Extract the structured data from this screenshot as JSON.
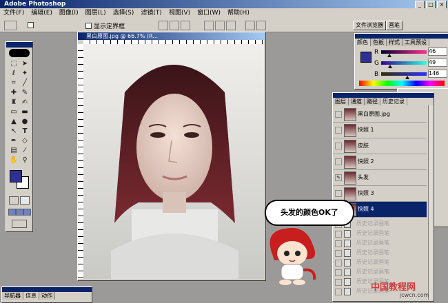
{
  "app": {
    "title": "Adobe Photoshop"
  },
  "menubar": [
    "文件(F)",
    "编辑(E)",
    "图像(I)",
    "图层(L)",
    "选择(S)",
    "滤镜(T)",
    "视图(V)",
    "窗口(W)",
    "帮助(H)"
  ],
  "options_bar": {
    "show_bounds_label": "显示定界框",
    "tab_file_browser": "文件浏览器",
    "tab_brushes": "画笔"
  },
  "document": {
    "title": "黑白原图.jpg @ 66.7% (R..."
  },
  "color_panel": {
    "tabs": [
      "颜色",
      "色板",
      "样式",
      "工具预设"
    ],
    "channels": [
      {
        "label": "R",
        "value": "46",
        "pct": 0.18
      },
      {
        "label": "G",
        "value": "49",
        "pct": 0.19
      },
      {
        "label": "B",
        "value": "146",
        "pct": 0.57
      }
    ],
    "swatch_color": "#2e3192"
  },
  "history_panel": {
    "tabs": [
      "图层",
      "通道",
      "路径",
      "历史记录"
    ],
    "items": [
      {
        "label": "黑白原图.jpg"
      },
      {
        "label": "快照 1"
      },
      {
        "label": "皮肤"
      },
      {
        "label": "快照 2"
      },
      {
        "label": "头发"
      },
      {
        "label": "快照 3"
      },
      {
        "label": "快照 4"
      }
    ],
    "ghost_label": "历史记录画笔"
  },
  "bottom_panel": {
    "tabs": [
      "导航器",
      "信息",
      "动作"
    ]
  },
  "bubble": {
    "text": "头发的颜色OK了"
  },
  "watermark": {
    "text": "中国教程网",
    "url": "jcwcn.com"
  }
}
